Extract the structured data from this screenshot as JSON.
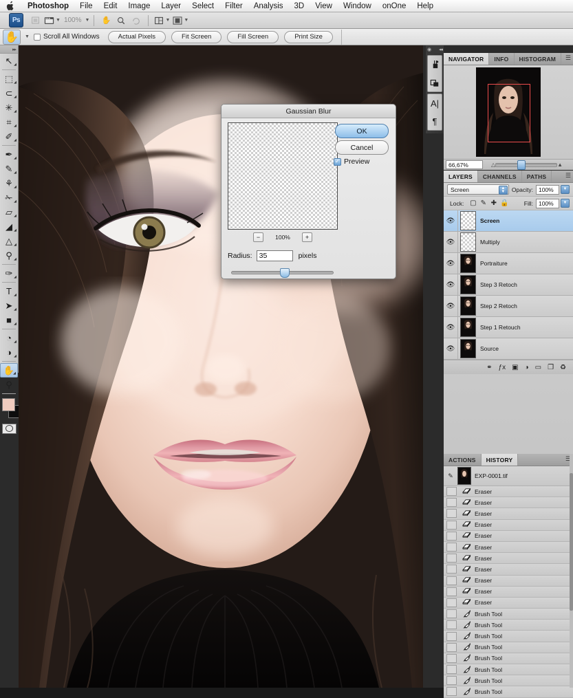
{
  "menubar": {
    "apple_icon": "apple-logo",
    "items": [
      {
        "label": "Photoshop",
        "bold": true
      },
      {
        "label": "File",
        "bold": false
      },
      {
        "label": "Edit",
        "bold": false
      },
      {
        "label": "Image",
        "bold": false
      },
      {
        "label": "Layer",
        "bold": false
      },
      {
        "label": "Select",
        "bold": false
      },
      {
        "label": "Filter",
        "bold": false
      },
      {
        "label": "Analysis",
        "bold": false
      },
      {
        "label": "3D",
        "bold": false
      },
      {
        "label": "View",
        "bold": false
      },
      {
        "label": "Window",
        "bold": false
      },
      {
        "label": "onOne",
        "bold": false
      },
      {
        "label": "Help",
        "bold": false
      }
    ]
  },
  "appbar": {
    "logo_label": "Ps",
    "zoom_value": "100%",
    "icons": [
      "bridge-icon",
      "mini-bridge-icon",
      "hand-icon",
      "zoom-icon",
      "rotate-view-icon",
      "arrange-documents-icon",
      "screen-mode-icon"
    ]
  },
  "optionsbar": {
    "tool_icon": "hand-tool-icon",
    "scroll_all_windows": "Scroll All Windows",
    "scroll_all_windows_checked": false,
    "buttons": [
      "Actual Pixels",
      "Fit Screen",
      "Fill Screen",
      "Print Size"
    ]
  },
  "toolbar": {
    "tools": [
      {
        "name": "move-tool",
        "glyph": "↖",
        "sub": true,
        "selected": false
      },
      {
        "name": "rectangular-marquee-tool",
        "glyph": "⬚",
        "sub": true,
        "selected": false
      },
      {
        "name": "lasso-tool",
        "glyph": "⊂",
        "sub": true,
        "selected": false
      },
      {
        "name": "magic-wand-tool",
        "glyph": "✳",
        "sub": true,
        "selected": false
      },
      {
        "name": "crop-tool",
        "glyph": "⌗",
        "sub": true,
        "selected": false
      },
      {
        "name": "eyedropper-tool",
        "glyph": "✐",
        "sub": true,
        "selected": false
      },
      {
        "name": "healing-brush-tool",
        "glyph": "✒",
        "sub": true,
        "selected": false
      },
      {
        "name": "brush-tool",
        "glyph": "✎",
        "sub": true,
        "selected": false
      },
      {
        "name": "clone-stamp-tool",
        "glyph": "⚘",
        "sub": true,
        "selected": false
      },
      {
        "name": "history-brush-tool",
        "glyph": "✁",
        "sub": true,
        "selected": false
      },
      {
        "name": "eraser-tool",
        "glyph": "▱",
        "sub": true,
        "selected": false
      },
      {
        "name": "gradient-tool",
        "glyph": "◢",
        "sub": true,
        "selected": false
      },
      {
        "name": "blur-tool",
        "glyph": "△",
        "sub": true,
        "selected": false
      },
      {
        "name": "dodge-tool",
        "glyph": "⚲",
        "sub": true,
        "selected": false
      },
      {
        "name": "pen-tool",
        "glyph": "✑",
        "sub": true,
        "selected": false
      },
      {
        "name": "horizontal-type-tool",
        "glyph": "T",
        "sub": true,
        "selected": false
      },
      {
        "name": "path-selection-tool",
        "glyph": "➤",
        "sub": true,
        "selected": false
      },
      {
        "name": "rectangle-tool",
        "glyph": "■",
        "sub": true,
        "selected": false
      },
      {
        "name": "3d-rotate-tool",
        "glyph": "◔",
        "sub": true,
        "selected": false
      },
      {
        "name": "3d-orbit-tool",
        "glyph": "◑",
        "sub": true,
        "selected": false
      },
      {
        "name": "hand-tool",
        "glyph": "✋",
        "sub": true,
        "selected": true
      },
      {
        "name": "zoom-tool",
        "glyph": "⚲",
        "sub": false,
        "selected": false
      }
    ],
    "foreground_color": "#f0ccbf",
    "background_color": "#0d0d0d",
    "quick_mask_icon": "quick-mask-icon"
  },
  "dock": {
    "buttons": [
      {
        "name": "brush-panel-icon",
        "glyph": "⑂"
      },
      {
        "name": "clone-source-panel-icon",
        "glyph": "⎙"
      },
      {
        "name": "character-panel-icon",
        "glyph": "A"
      },
      {
        "name": "paragraph-panel-icon",
        "glyph": "¶"
      }
    ]
  },
  "dialog": {
    "title": "Gaussian Blur",
    "ok_label": "OK",
    "cancel_label": "Cancel",
    "preview_label": "Preview",
    "preview_checked": true,
    "zoom_out_label": "−",
    "zoom_level": "100%",
    "zoom_in_label": "+",
    "radius_label": "Radius:",
    "radius_value": "35",
    "radius_units": "pixels",
    "accent_color": "#8ec0ec"
  },
  "navigator": {
    "tabs": [
      {
        "label": "NAVIGATOR",
        "active": true
      },
      {
        "label": "INFO",
        "active": false
      },
      {
        "label": "HISTOGRAM",
        "active": false
      }
    ],
    "zoom_value": "66,67%",
    "zoom_out_icon": "small-mountain-icon",
    "zoom_in_icon": "large-mountain-icon",
    "view_box_color": "#ef4d4d"
  },
  "layers": {
    "tabs": [
      {
        "label": "LAYERS",
        "active": true
      },
      {
        "label": "CHANNELS",
        "active": false
      },
      {
        "label": "PATHS",
        "active": false
      }
    ],
    "blend_mode": "Screen",
    "opacity_label": "Opacity:",
    "opacity_value": "100%",
    "lock_label": "Lock:",
    "lock_icons": [
      "lock-transparent-pixels-icon",
      "lock-image-pixels-icon",
      "lock-position-icon",
      "lock-all-icon"
    ],
    "fill_label": "Fill:",
    "fill_value": "100%",
    "items": [
      {
        "name": "Screen",
        "active": true,
        "kind": "checker",
        "visible": true
      },
      {
        "name": "Multiply",
        "active": false,
        "kind": "checker",
        "visible": true
      },
      {
        "name": "Portraiture",
        "active": false,
        "kind": "photo",
        "visible": true
      },
      {
        "name": "Step 3 Retoch",
        "active": false,
        "kind": "photo",
        "visible": true
      },
      {
        "name": "Step 2 Retoch",
        "active": false,
        "kind": "photo",
        "visible": true
      },
      {
        "name": "Step 1 Retouch",
        "active": false,
        "kind": "photo",
        "visible": true
      },
      {
        "name": "Source",
        "active": false,
        "kind": "photo",
        "visible": true
      }
    ],
    "bottom_buttons": [
      {
        "name": "link-layers-icon",
        "glyph": "⚭"
      },
      {
        "name": "layer-style-icon",
        "glyph": "ƒx"
      },
      {
        "name": "layer-mask-icon",
        "glyph": "▣"
      },
      {
        "name": "adjustment-layer-icon",
        "glyph": "◑"
      },
      {
        "name": "new-group-icon",
        "glyph": "▭"
      },
      {
        "name": "new-layer-icon",
        "glyph": "❐"
      },
      {
        "name": "delete-layer-icon",
        "glyph": "♻"
      }
    ]
  },
  "history": {
    "tabs": [
      {
        "label": "ACTIONS",
        "active": false
      },
      {
        "label": "HISTORY",
        "active": true
      }
    ],
    "snapshot": "EXP-0001.tif",
    "items": [
      {
        "label": "Eraser",
        "icon": "eraser-icon"
      },
      {
        "label": "Eraser",
        "icon": "eraser-icon"
      },
      {
        "label": "Eraser",
        "icon": "eraser-icon"
      },
      {
        "label": "Eraser",
        "icon": "eraser-icon"
      },
      {
        "label": "Eraser",
        "icon": "eraser-icon"
      },
      {
        "label": "Eraser",
        "icon": "eraser-icon"
      },
      {
        "label": "Eraser",
        "icon": "eraser-icon"
      },
      {
        "label": "Eraser",
        "icon": "eraser-icon"
      },
      {
        "label": "Eraser",
        "icon": "eraser-icon"
      },
      {
        "label": "Eraser",
        "icon": "eraser-icon"
      },
      {
        "label": "Eraser",
        "icon": "eraser-icon"
      },
      {
        "label": "Brush Tool",
        "icon": "brush-icon"
      },
      {
        "label": "Brush Tool",
        "icon": "brush-icon"
      },
      {
        "label": "Brush Tool",
        "icon": "brush-icon"
      },
      {
        "label": "Brush Tool",
        "icon": "brush-icon"
      },
      {
        "label": "Brush Tool",
        "icon": "brush-icon"
      },
      {
        "label": "Brush Tool",
        "icon": "brush-icon"
      },
      {
        "label": "Brush Tool",
        "icon": "brush-icon"
      },
      {
        "label": "Brush Tool",
        "icon": "brush-icon"
      }
    ]
  }
}
